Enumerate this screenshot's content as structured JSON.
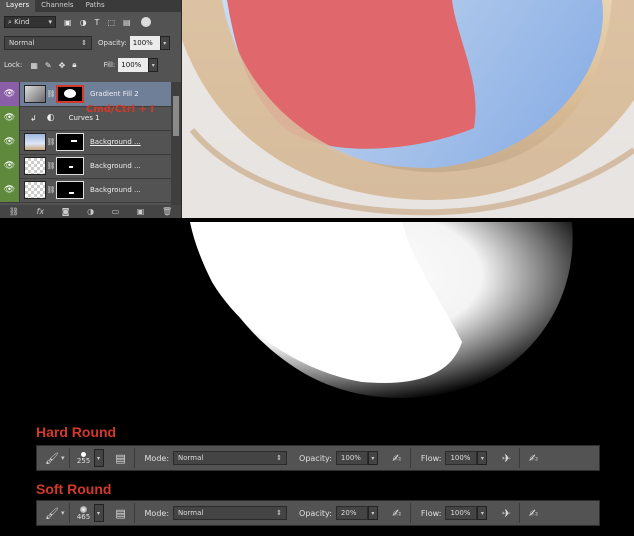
{
  "layers_panel": {
    "tabs": [
      "Layers",
      "Channels",
      "Paths"
    ],
    "filter_kind": "Kind",
    "blend_mode": "Normal",
    "opacity_label": "Opacity:",
    "opacity_value": "100%",
    "lock_label": "Lock:",
    "fill_label": "Fill:",
    "fill_value": "100%",
    "overlay_text": "Cmd/Ctrl + I",
    "layers": [
      {
        "name": "Gradient Fill 2"
      },
      {
        "name": "Curves 1"
      },
      {
        "name": "Background ..."
      },
      {
        "name": "Background ..."
      },
      {
        "name": "Background ..."
      }
    ]
  },
  "toolbars": [
    {
      "heading": "Hard Round",
      "brush_size": "255",
      "mode_label": "Mode:",
      "mode_value": "Normal",
      "opacity_label": "Opacity:",
      "opacity_value": "100%",
      "flow_label": "Flow:",
      "flow_value": "100%"
    },
    {
      "heading": "Soft Round",
      "brush_size": "465",
      "mode_label": "Mode:",
      "mode_value": "Normal",
      "opacity_label": "Opacity:",
      "opacity_value": "20%",
      "flow_label": "Flow:",
      "flow_value": "100%"
    }
  ],
  "colors": {
    "panel": "#535353",
    "accent_red": "#d3392b",
    "eye_green": "#5f8a3e",
    "eye_violet": "#8a5fa8"
  }
}
